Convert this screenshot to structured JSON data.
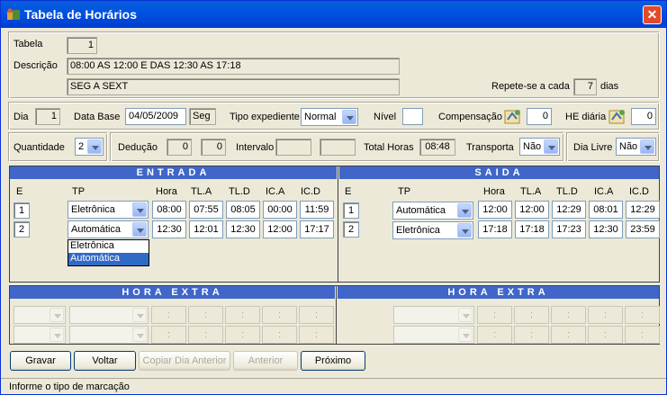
{
  "window": {
    "title": "Tabela de Horários",
    "close_label": "✕"
  },
  "header": {
    "tabela_label": "Tabela",
    "tabela_value": "1",
    "descricao_label": "Descrição",
    "descricao_1": "08:00  AS 12:00 E DAS 12:30 AS 17:18",
    "descricao_2": "SEG A SEXT",
    "repete_label": "Repete-se a cada",
    "repete_value": "7",
    "repete_unit": "dias"
  },
  "dia": {
    "dia_label": "Dia",
    "dia_value": "1",
    "data_base_label": "Data Base",
    "data_base_value": "04/05/2009",
    "weekday": "Seg",
    "tipo_label": "Tipo expediente",
    "tipo_value": "Normal",
    "nivel_label": "Nível",
    "nivel_value": "",
    "compensacao_label": "Compensação",
    "compensacao_value": "0",
    "he_label": "HE diária",
    "he_value": "0"
  },
  "qtd": {
    "quantidade_label": "Quantidade",
    "quantidade_value": "2",
    "deducao_label": "Dedução",
    "deducao_1": "0",
    "deducao_2": "0",
    "intervalo_label": "Intervalo",
    "total_label": "Total Horas",
    "total_value": "08:48",
    "transporta_label": "Transporta",
    "transporta_value": "Não",
    "dialivre_label": "Dia Livre",
    "dialivre_value": "Não"
  },
  "entrada": {
    "title": "ENTRADA",
    "headers": {
      "e": "E",
      "tp": "TP",
      "hora": "Hora",
      "tla": "TL.A",
      "tld": "TL.D",
      "ica": "IC.A",
      "icd": "IC.D"
    },
    "rows": [
      {
        "e": "1",
        "tp": "Eletrônica",
        "hora": "08:00",
        "tla": "07:55",
        "tld": "08:05",
        "ica": "00:00",
        "icd": "11:59"
      },
      {
        "e": "2",
        "tp": "Automática",
        "hora": "12:30",
        "tla": "12:01",
        "tld": "12:30",
        "ica": "12:00",
        "icd": "17:17"
      }
    ],
    "dropdown_options": [
      "Eletrônica",
      "Automática"
    ]
  },
  "saida": {
    "title": "SAIDA",
    "headers": {
      "e": "E",
      "tp": "TP",
      "hora": "Hora",
      "tla": "TL.A",
      "tld": "TL.D",
      "ica": "IC.A",
      "icd": "IC.D"
    },
    "rows": [
      {
        "e": "1",
        "tp": "Automática",
        "hora": "12:00",
        "tla": "12:00",
        "tld": "12:29",
        "ica": "08:01",
        "icd": "12:29"
      },
      {
        "e": "2",
        "tp": "Eletrônica",
        "hora": "17:18",
        "tla": "17:18",
        "tld": "17:23",
        "ica": "12:30",
        "icd": "23:59"
      }
    ]
  },
  "hora_extra": {
    "left_title": "HORA EXTRA",
    "right_title": "HORA EXTRA",
    "sep": ":"
  },
  "buttons": {
    "gravar": "Gravar",
    "voltar": "Voltar",
    "copiar": "Copiar Dia Anterior",
    "anterior": "Anterior",
    "proximo": "Próximo"
  },
  "status": {
    "text": "Informe o tipo de marcação"
  },
  "colors": {
    "titlebar": "#0053e1",
    "section": "#3f66c8",
    "highlight": "#316ac5"
  }
}
